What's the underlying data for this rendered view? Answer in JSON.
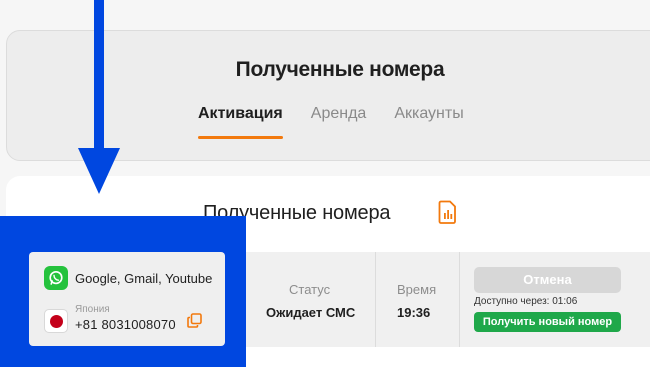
{
  "header": {
    "title": "Полученные номера",
    "tabs": [
      {
        "label": "Активация",
        "active": true
      },
      {
        "label": "Аренда",
        "active": false
      },
      {
        "label": "Аккаунты",
        "active": false
      }
    ]
  },
  "section": {
    "title": "Полученные номера"
  },
  "order": {
    "services": "Google, Gmail, Youtube",
    "country": "Япония",
    "country_code": "+81",
    "phone_number": "8031008070",
    "status_label": "Статус",
    "status_value": "Ожидает СМС",
    "time_label": "Время",
    "time_value": "19:36",
    "cancel_label": "Отмена",
    "available_text": "Доступно через: 01:06",
    "new_number_label": "Получить новый номер"
  },
  "colors": {
    "accent": "#f2790d",
    "highlight_blue": "#0047e0",
    "button_green": "#1fa84a",
    "button_disabled": "#d7d7d7"
  }
}
